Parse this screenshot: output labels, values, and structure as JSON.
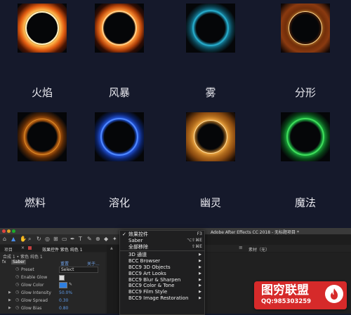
{
  "gallery": {
    "items": [
      {
        "label": "火焰"
      },
      {
        "label": "风暴"
      },
      {
        "label": "雾"
      },
      {
        "label": "分形"
      },
      {
        "label": "燃料"
      },
      {
        "label": "溶化"
      },
      {
        "label": "幽灵"
      },
      {
        "label": "魔法"
      }
    ]
  },
  "ae_window": {
    "title": "Adobe After Effects CC 2018 - 无标题项目 *",
    "project_tab": "项目",
    "effects_tab": "效果控件 紫色 纯色 1",
    "comp_path": "合成 1 • 紫色 纯色 1",
    "effect_name": "Saber",
    "reset_label": "重置",
    "about_label": "关于...",
    "props": [
      {
        "name": "Preset",
        "value": "Select"
      },
      {
        "name": "Enable Glow",
        "value": ""
      },
      {
        "name": "Glow Color",
        "value": ""
      },
      {
        "name": "Glow Intensity",
        "value": "50.0%"
      },
      {
        "name": "Glow Spread",
        "value": "0.30"
      },
      {
        "name": "Glow Bias",
        "value": "0.80"
      }
    ],
    "viewer_label": "素材（无）",
    "colors": {
      "glow_color": "#2f7fe0",
      "accent": "#3e7bd6"
    }
  },
  "context_menu": {
    "items": [
      {
        "label": "效果控件",
        "shortcut": "F3",
        "checked": true
      },
      {
        "label": "Saber",
        "shortcut": "⌥⇧⌘E"
      },
      {
        "label": "全部移除",
        "shortcut": "⇧⌘E"
      },
      {
        "label": "3D 通道",
        "submenu": true
      },
      {
        "label": "BCC Browser",
        "submenu": true
      },
      {
        "label": "BCC9 3D Objects",
        "submenu": true
      },
      {
        "label": "BCC9 Art Looks",
        "submenu": true
      },
      {
        "label": "BCC9 Blur & Sharpen",
        "submenu": true
      },
      {
        "label": "BCC9 Color & Tone",
        "submenu": true
      },
      {
        "label": "BCC9 Film Style",
        "submenu": true
      },
      {
        "label": "BCC9 Image Restoration",
        "submenu": true
      }
    ]
  },
  "badge": {
    "title": "图穷联盟",
    "qq": "QQ:985303259"
  }
}
